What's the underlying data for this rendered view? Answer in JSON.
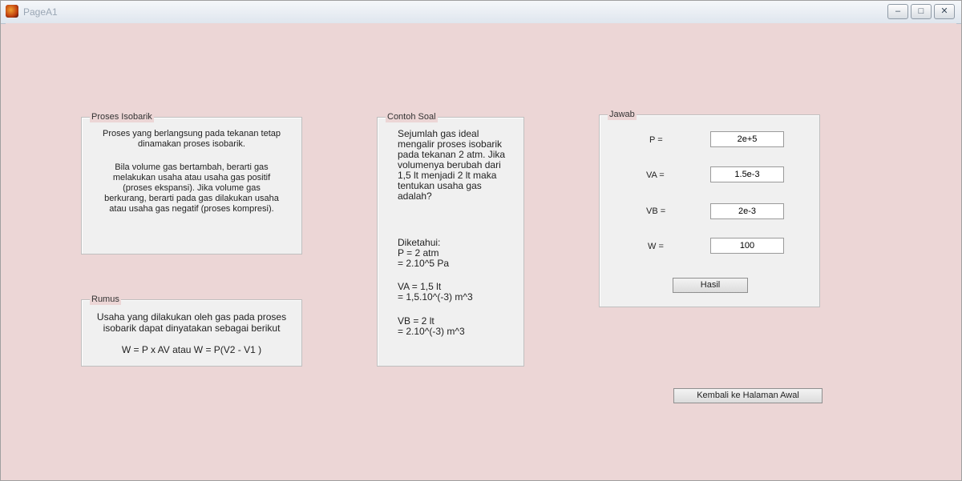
{
  "window": {
    "title": "PageA1",
    "controls": [
      "minimize",
      "maximize",
      "close"
    ]
  },
  "panels": {
    "isobarik": {
      "title": "Proses Isobarik",
      "p1": "Proses yang berlangsung pada tekanan tetap dinamakan proses isobarik.",
      "p2": "Bila volume gas bertambah, berarti gas melakukan usaha atau usaha gas positif (proses ekspansi). Jika volume gas berkurang, berarti pada gas dilakukan usaha atau usaha gas negatif (proses kompresi)."
    },
    "rumus": {
      "title": "Rumus",
      "text": "Usaha yang dilakukan oleh gas pada proses isobarik dapat dinyatakan sebagai berikut",
      "formula": "W = P x AV atau W = P(V2 - V1 )"
    },
    "contoh": {
      "title": "Contoh Soal",
      "question": "Sejumlah gas ideal mengalir proses isobarik pada tekanan 2 atm. Jika volumenya berubah dari 1,5 lt menjadi 2 lt maka tentukan usaha gas adalah?",
      "diketahui": "Diketahui:",
      "p_line1": "P = 2 atm",
      "p_line2": "= 2.10^5 Pa",
      "va_line1": "VA = 1,5 lt",
      "va_line2": "= 1,5.10^(-3) m^3",
      "vb_line1": "VB = 2 lt",
      "vb_line2": "= 2.10^(-3) m^3"
    },
    "jawab": {
      "title": "Jawab",
      "p_label": "P =",
      "p_value": "2e+5",
      "va_label": "VA =",
      "va_value": "1.5e-3",
      "vb_label": "VB =",
      "vb_value": "2e-3",
      "w_label": "W =",
      "w_value": "100",
      "hasil_button": "Hasil"
    }
  },
  "back_button": "Kembali ke Halaman Awal",
  "colors": {
    "background": "#ecd6d6",
    "panel": "#f0f0f0"
  }
}
